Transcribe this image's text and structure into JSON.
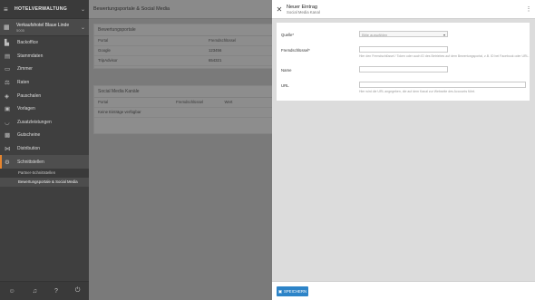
{
  "sidebar": {
    "title": "HOTELVERWALTUNG",
    "hotel_name": "Verkaufshotel Blaue Linde",
    "hotel_sub": "5005",
    "items": [
      {
        "label": "Backoffice",
        "icon": "building-icon"
      },
      {
        "label": "Stammdaten",
        "icon": "document-icon"
      },
      {
        "label": "Zimmer",
        "icon": "bed-icon"
      },
      {
        "label": "Raten",
        "icon": "rates-icon"
      },
      {
        "label": "Pauschalen",
        "icon": "tag-icon"
      },
      {
        "label": "Vorlagen",
        "icon": "templates-icon"
      },
      {
        "label": "Zusatzleistungen",
        "icon": "service-icon"
      },
      {
        "label": "Gutscheine",
        "icon": "gift-icon"
      },
      {
        "label": "Distribution",
        "icon": "distribution-icon"
      },
      {
        "label": "Schnittstellen",
        "icon": "plug-icon"
      }
    ],
    "subitems": [
      "Partner-Schnittstellen",
      "Bewertungsportale & Social Media"
    ],
    "footer_icons": [
      "user-icon",
      "bell-icon",
      "help-icon",
      "power-icon"
    ]
  },
  "main": {
    "title": "Bewertungsportale & Social Media",
    "card1": {
      "title": "Bewertungsportale",
      "headers": [
        "Portal",
        "Fremdschlüssel"
      ],
      "rows": [
        [
          "Google",
          "123456"
        ],
        [
          "TripAdvisor",
          "654321"
        ]
      ]
    },
    "card2": {
      "title": "Social Media Kanäle",
      "headers": [
        "Portal",
        "Fremdschlüssel",
        "Wert"
      ],
      "empty": "Keine Einträge verfügbar"
    }
  },
  "panel": {
    "title": "Neuer Eintrag",
    "subtitle": "Social Media Kanal",
    "fields": {
      "quelle_label": "Quelle*",
      "quelle_placeholder": "Bitte auswählen",
      "fremd_label": "Fremdschlüssel*",
      "fremd_hint": "Hier den Fremdschlüssel / Token oder auch ID des Betriebes auf dem Bewertungsportal, z.B. ID bei Facebook oder URL.",
      "name_label": "Name",
      "url_label": "URL",
      "url_hint": "Hier wird die URL angegeben, die auf dem Kanal zur Webseite des Accounts führt."
    },
    "save_label": "SPEICHERN"
  },
  "colors": {
    "accent": "#e8852e",
    "primary": "#2d84c8"
  }
}
